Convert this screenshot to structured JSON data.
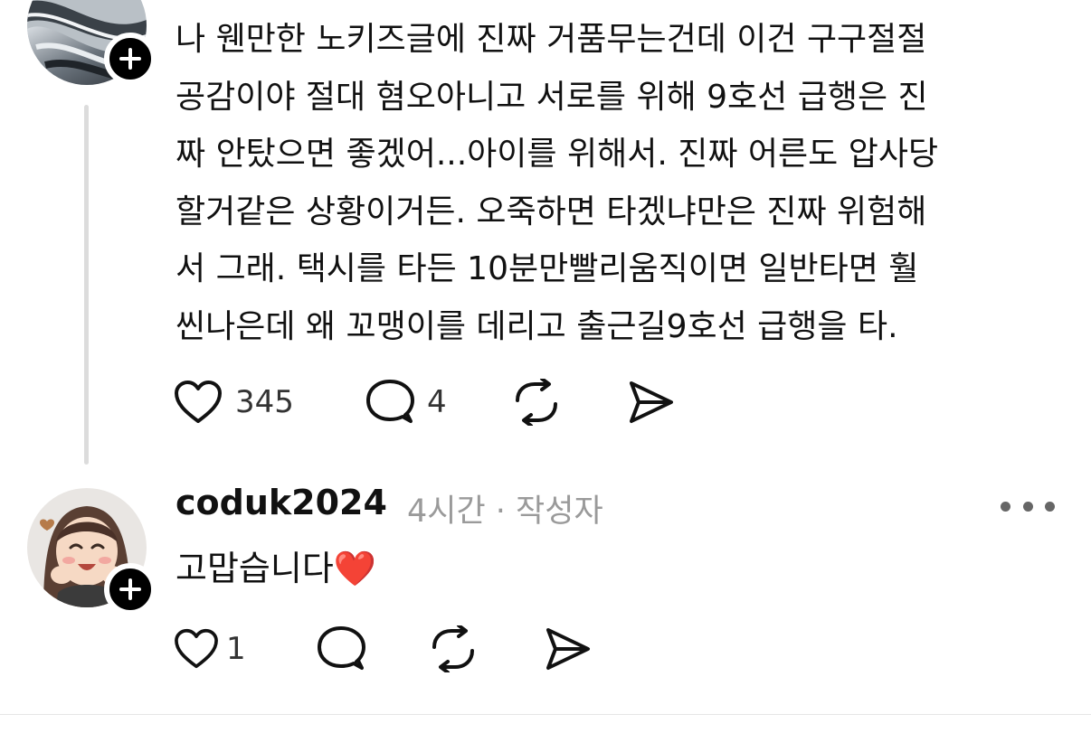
{
  "post": {
    "lines": [
      "나 웬만한 노키즈글에 진짜 거품무는건데 이건 구구절절",
      "공감이야 절대 혐오아니고 서로를 위해 9호선 급행은 진",
      "짜 안탔으면 좋겠어...아이를 위해서. 진짜 어른도 압사당",
      "할거같은 상황이거든. 오죽하면 타겠냐만은 진짜 위험해",
      "서 그래. 택시를 타든 10분만빨리움직이면 일반타면 훨",
      "씬나은데 왜 꼬맹이를 데리고 출근길9호선 급행을 타."
    ],
    "actions": {
      "like_count": "345",
      "reply_count": "4"
    }
  },
  "reply": {
    "username": "coduk2024",
    "meta": "4시간 · 작성자",
    "text": "고맙습니다❤️",
    "actions": {
      "like_count": "1"
    }
  },
  "icons": {
    "like": "heart-outline-icon",
    "comment": "speech-bubble-icon",
    "repost": "repost-arrows-icon",
    "share": "paper-plane-icon",
    "follow": "plus-icon",
    "more": "more-dots-icon"
  },
  "colors": {
    "text": "#111111",
    "muted": "#9a9a9a",
    "thread_line": "#dcdcdc",
    "badge": "#000000",
    "heart": "#e0242e"
  }
}
